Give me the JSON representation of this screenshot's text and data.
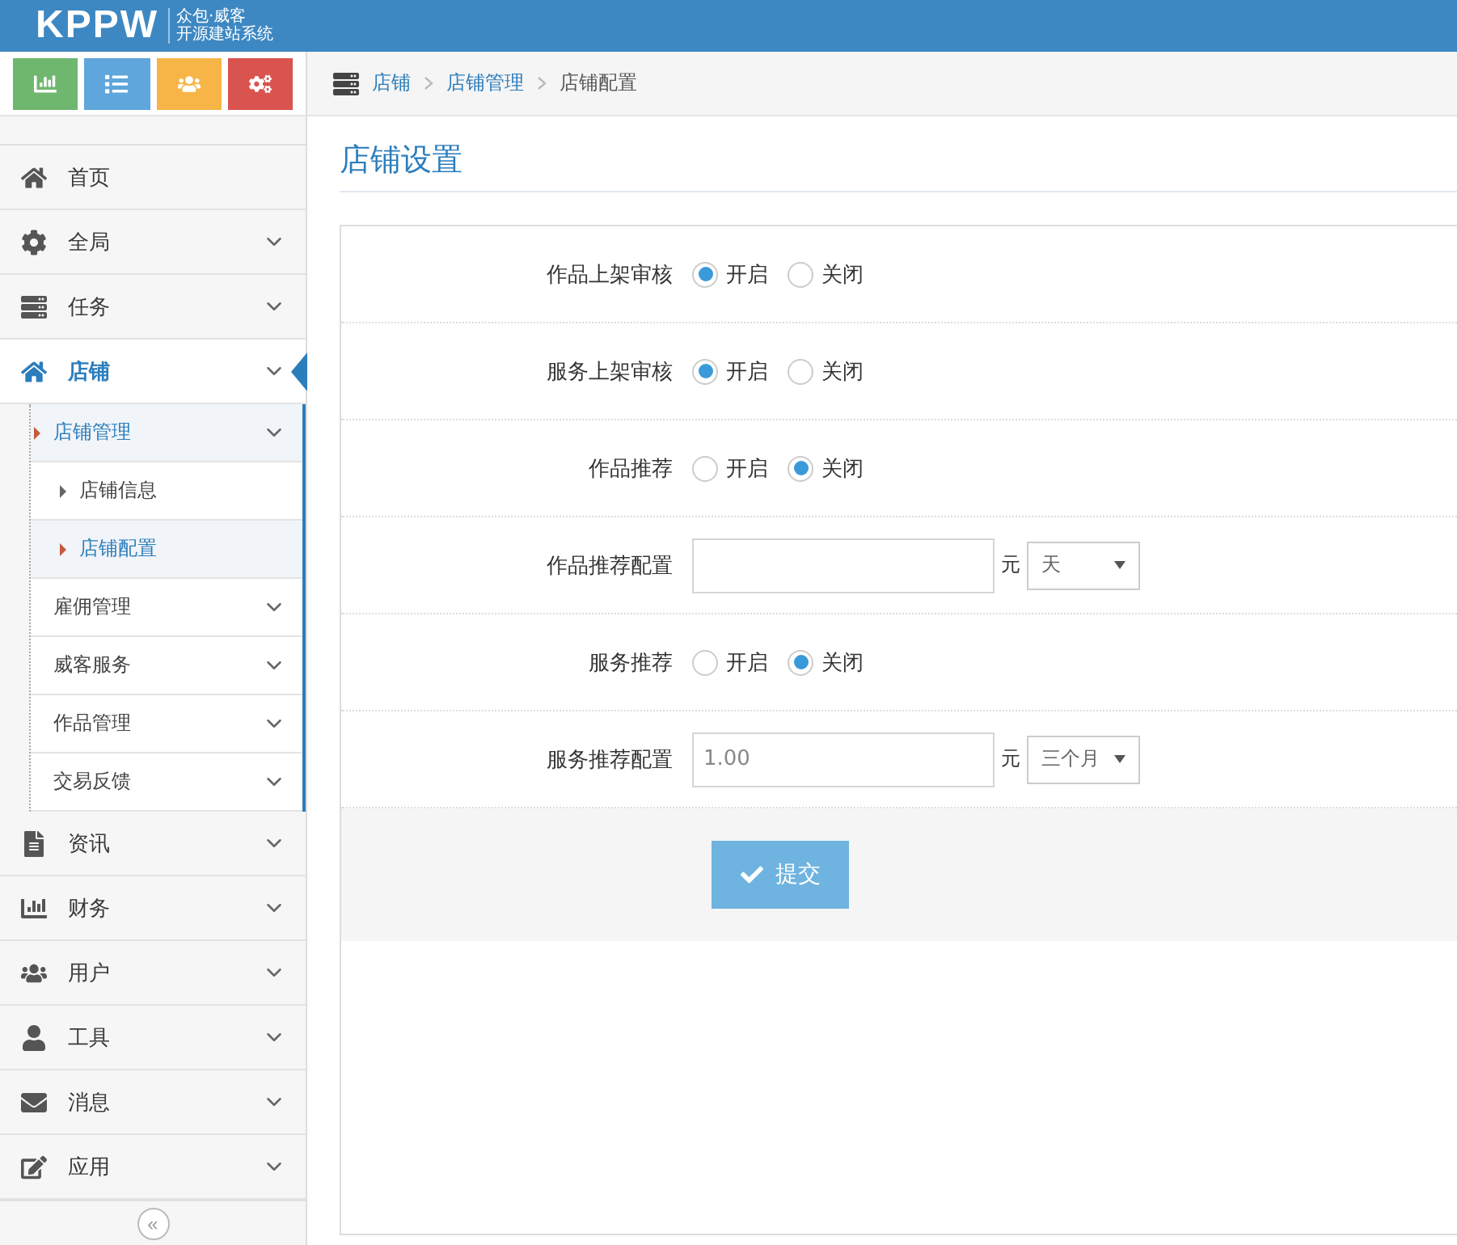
{
  "header": {
    "logo": "KPPW",
    "slogan": "众包·威客",
    "subtitle": "开源建站系统"
  },
  "quick_buttons": [
    {
      "kind": "chart",
      "color": "#6fb76f"
    },
    {
      "kind": "list",
      "color": "#5ea6dc"
    },
    {
      "kind": "users",
      "color": "#f7b547"
    },
    {
      "kind": "gears",
      "color": "#d9534f"
    }
  ],
  "sidebar": {
    "items": [
      {
        "label": "首页",
        "kind": "home",
        "selected": false,
        "expandable": false
      },
      {
        "label": "全局",
        "kind": "gear",
        "selected": false,
        "expandable": true
      },
      {
        "label": "任务",
        "kind": "list",
        "selected": false,
        "expandable": true
      },
      {
        "label": "店铺",
        "kind": "home",
        "selected": true,
        "expandable": true,
        "children": [
          {
            "label": "店铺管理",
            "selected": true,
            "expandable": true,
            "children": [
              {
                "label": "店铺信息",
                "selected": false
              },
              {
                "label": "店铺配置",
                "selected": true
              }
            ]
          },
          {
            "label": "雇佣管理",
            "selected": false,
            "expandable": true
          },
          {
            "label": "威客服务",
            "selected": false,
            "expandable": true
          },
          {
            "label": "作品管理",
            "selected": false,
            "expandable": true
          },
          {
            "label": "交易反馈",
            "selected": false,
            "expandable": true
          }
        ]
      },
      {
        "label": "资讯",
        "kind": "file",
        "selected": false,
        "expandable": true
      },
      {
        "label": "财务",
        "kind": "chart",
        "selected": false,
        "expandable": true
      },
      {
        "label": "用户",
        "kind": "users",
        "selected": false,
        "expandable": true
      },
      {
        "label": "工具",
        "kind": "user",
        "selected": false,
        "expandable": true
      },
      {
        "label": "消息",
        "kind": "mail",
        "selected": false,
        "expandable": true
      },
      {
        "label": "应用",
        "kind": "edit",
        "selected": false,
        "expandable": true
      }
    ],
    "collapse": "«"
  },
  "breadcrumb": [
    "店铺",
    "店铺管理",
    "店铺配置"
  ],
  "page_title": "店铺设置",
  "form": {
    "rows": [
      {
        "kind": "radio",
        "label": "作品上架审核",
        "options": [
          {
            "label": "开启",
            "selected": true
          },
          {
            "label": "关闭",
            "selected": false
          }
        ]
      },
      {
        "kind": "radio",
        "label": "服务上架审核",
        "options": [
          {
            "label": "开启",
            "selected": true
          },
          {
            "label": "关闭",
            "selected": false
          }
        ]
      },
      {
        "kind": "radio",
        "label": "作品推荐",
        "options": [
          {
            "label": "开启",
            "selected": false
          },
          {
            "label": "关闭",
            "selected": true
          }
        ]
      },
      {
        "kind": "price",
        "label": "作品推荐配置",
        "unit": "元",
        "period": "天"
      },
      {
        "kind": "radio",
        "label": "服务推荐",
        "options": [
          {
            "label": "开启",
            "selected": false
          },
          {
            "label": "关闭",
            "selected": true
          }
        ]
      },
      {
        "kind": "price",
        "label": "服务推荐配置",
        "value": "1.00",
        "unit": "元",
        "period": "三个月"
      }
    ],
    "submit": "提交"
  }
}
